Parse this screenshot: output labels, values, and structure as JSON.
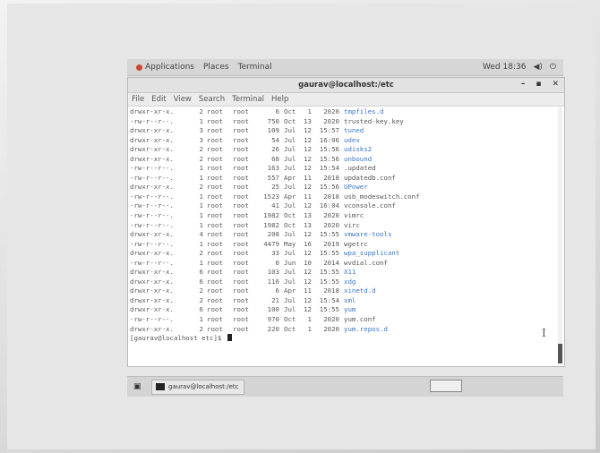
{
  "topbar": {
    "applications": "Applications",
    "places": "Places",
    "terminal": "Terminal",
    "clock": "Wed 18:36"
  },
  "window": {
    "title": "gaurav@localhost:/etc",
    "menu": [
      "File",
      "Edit",
      "View",
      "Search",
      "Terminal",
      "Help"
    ]
  },
  "listing": [
    {
      "perm": "drwxr-xr-x.",
      "links": "2",
      "owner": "root",
      "group": "root",
      "size": "6",
      "mon": "Oct",
      "day": "1",
      "time": "2020",
      "name": "tmpfiles.d",
      "type": "dir"
    },
    {
      "perm": "-rw-r--r--.",
      "links": "1",
      "owner": "root",
      "group": "root",
      "size": "750",
      "mon": "Oct",
      "day": "13",
      "time": "2020",
      "name": "trusted-key.key",
      "type": "file"
    },
    {
      "perm": "drwxr-xr-x.",
      "links": "3",
      "owner": "root",
      "group": "root",
      "size": "109",
      "mon": "Jul",
      "day": "12",
      "time": "15:57",
      "name": "tuned",
      "type": "dir"
    },
    {
      "perm": "drwxr-xr-x.",
      "links": "3",
      "owner": "root",
      "group": "root",
      "size": "54",
      "mon": "Jul",
      "day": "12",
      "time": "16:06",
      "name": "udev",
      "type": "dir"
    },
    {
      "perm": "drwxr-xr-x.",
      "links": "2",
      "owner": "root",
      "group": "root",
      "size": "26",
      "mon": "Jul",
      "day": "12",
      "time": "15:56",
      "name": "udisks2",
      "type": "dir"
    },
    {
      "perm": "drwxr-xr-x.",
      "links": "2",
      "owner": "root",
      "group": "root",
      "size": "68",
      "mon": "Jul",
      "day": "12",
      "time": "15:56",
      "name": "unbound",
      "type": "dir"
    },
    {
      "perm": "-rw-r--r--.",
      "links": "1",
      "owner": "root",
      "group": "root",
      "size": "163",
      "mon": "Jul",
      "day": "12",
      "time": "15:54",
      "name": ".updated",
      "type": "file"
    },
    {
      "perm": "-rw-r--r--.",
      "links": "1",
      "owner": "root",
      "group": "root",
      "size": "557",
      "mon": "Apr",
      "day": "11",
      "time": "2018",
      "name": "updatedb.conf",
      "type": "file"
    },
    {
      "perm": "drwxr-xr-x.",
      "links": "2",
      "owner": "root",
      "group": "root",
      "size": "25",
      "mon": "Jul",
      "day": "12",
      "time": "15:56",
      "name": "UPower",
      "type": "dir"
    },
    {
      "perm": "-rw-r--r--.",
      "links": "1",
      "owner": "root",
      "group": "root",
      "size": "1523",
      "mon": "Apr",
      "day": "11",
      "time": "2018",
      "name": "usb_modeswitch.conf",
      "type": "file"
    },
    {
      "perm": "-rw-r--r--.",
      "links": "1",
      "owner": "root",
      "group": "root",
      "size": "41",
      "mon": "Jul",
      "day": "12",
      "time": "16:04",
      "name": "vconsole.conf",
      "type": "file"
    },
    {
      "perm": "-rw-r--r--.",
      "links": "1",
      "owner": "root",
      "group": "root",
      "size": "1982",
      "mon": "Oct",
      "day": "13",
      "time": "2020",
      "name": "vimrc",
      "type": "file"
    },
    {
      "perm": "-rw-r--r--.",
      "links": "1",
      "owner": "root",
      "group": "root",
      "size": "1982",
      "mon": "Oct",
      "day": "13",
      "time": "2020",
      "name": "virc",
      "type": "file"
    },
    {
      "perm": "drwxr-xr-x.",
      "links": "4",
      "owner": "root",
      "group": "root",
      "size": "208",
      "mon": "Jul",
      "day": "12",
      "time": "15:55",
      "name": "vmware-tools",
      "type": "dir"
    },
    {
      "perm": "-rw-r--r--.",
      "links": "1",
      "owner": "root",
      "group": "root",
      "size": "4479",
      "mon": "May",
      "day": "16",
      "time": "2019",
      "name": "wgetrc",
      "type": "file"
    },
    {
      "perm": "drwxr-xr-x.",
      "links": "2",
      "owner": "root",
      "group": "root",
      "size": "33",
      "mon": "Jul",
      "day": "12",
      "time": "15:55",
      "name": "wpa_supplicant",
      "type": "dir"
    },
    {
      "perm": "-rw-r--r--.",
      "links": "1",
      "owner": "root",
      "group": "root",
      "size": "0",
      "mon": "Jun",
      "day": "10",
      "time": "2014",
      "name": "wvdial.conf",
      "type": "file"
    },
    {
      "perm": "drwxr-xr-x.",
      "links": "6",
      "owner": "root",
      "group": "root",
      "size": "103",
      "mon": "Jul",
      "day": "12",
      "time": "15:55",
      "name": "X11",
      "type": "dir"
    },
    {
      "perm": "drwxr-xr-x.",
      "links": "6",
      "owner": "root",
      "group": "root",
      "size": "116",
      "mon": "Jul",
      "day": "12",
      "time": "15:55",
      "name": "xdg",
      "type": "dir"
    },
    {
      "perm": "drwxr-xr-x.",
      "links": "2",
      "owner": "root",
      "group": "root",
      "size": "6",
      "mon": "Apr",
      "day": "11",
      "time": "2018",
      "name": "xinetd.d",
      "type": "dir"
    },
    {
      "perm": "drwxr-xr-x.",
      "links": "2",
      "owner": "root",
      "group": "root",
      "size": "21",
      "mon": "Jul",
      "day": "12",
      "time": "15:54",
      "name": "xml",
      "type": "dir"
    },
    {
      "perm": "drwxr-xr-x.",
      "links": "6",
      "owner": "root",
      "group": "root",
      "size": "100",
      "mon": "Jul",
      "day": "12",
      "time": "15:55",
      "name": "yum",
      "type": "dir"
    },
    {
      "perm": "-rw-r--r--.",
      "links": "1",
      "owner": "root",
      "group": "root",
      "size": "970",
      "mon": "Oct",
      "day": "1",
      "time": "2020",
      "name": "yum.conf",
      "type": "file"
    },
    {
      "perm": "drwxr-xr-x.",
      "links": "2",
      "owner": "root",
      "group": "root",
      "size": "220",
      "mon": "Oct",
      "day": "1",
      "time": "2020",
      "name": "yum.repos.d",
      "type": "dir"
    }
  ],
  "prompt": "[gaurav@localhost etc]$ ",
  "taskbar": {
    "window_label": "gaurav@localhost:/etc"
  },
  "colors": {
    "directory": "#3a77c9",
    "text": "#555555"
  }
}
